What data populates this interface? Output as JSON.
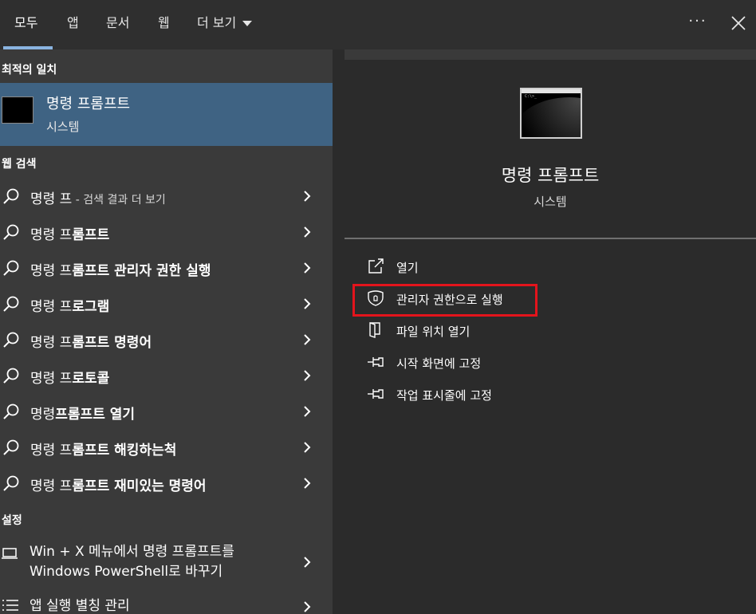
{
  "tabs": [
    {
      "label": "모두",
      "active": true
    },
    {
      "label": "앱"
    },
    {
      "label": "문서"
    },
    {
      "label": "웹"
    },
    {
      "label": "더 보기"
    }
  ],
  "sections": {
    "best_match": "최적의 일치",
    "web_search": "웹 검색",
    "settings": "설정"
  },
  "best_match": {
    "title": "명령 프롬프트",
    "subtitle": "시스템"
  },
  "web_results": [
    {
      "prefix": "명령 프",
      "bold": "",
      "hint": " - 검색 결과 더 보기"
    },
    {
      "prefix": "명령 프",
      "bold": "롬프트",
      "hint": ""
    },
    {
      "prefix": "명령 프",
      "bold": "롬프트 관리자 권한 실행",
      "hint": ""
    },
    {
      "prefix": "명령 프",
      "bold": "로그램",
      "hint": ""
    },
    {
      "prefix": "명령 프",
      "bold": "롬프트 명령어",
      "hint": ""
    },
    {
      "prefix": "명령 프",
      "bold": "로토콜",
      "hint": ""
    },
    {
      "prefix": "명령",
      "bold": "프롬프트 열기",
      "hint": ""
    },
    {
      "prefix": "명령 프",
      "bold": "롬프트 해킹하는척",
      "hint": ""
    },
    {
      "prefix": "명령 프",
      "bold": "롬프트 재미있는 명령어",
      "hint": ""
    }
  ],
  "settings_results": [
    {
      "line1": "Win + X 메뉴에서 명령 프롬프트를",
      "line2": "Windows PowerShell로 바꾸기"
    },
    {
      "line1": "앱 실행 별칭 관리",
      "line2": ""
    }
  ],
  "detail": {
    "title": "명령 프롬프트",
    "subtitle": "시스템",
    "icon_prompt": "C:\\>_",
    "actions": [
      {
        "label": "열기",
        "icon": "open-external-icon"
      },
      {
        "label": "관리자 권한으로 실행",
        "icon": "shield-icon"
      },
      {
        "label": "파일 위치 열기",
        "icon": "file-location-icon"
      },
      {
        "label": "시작 화면에 고정",
        "icon": "pin-icon"
      },
      {
        "label": "작업 표시줄에 고정",
        "icon": "pin-icon"
      }
    ]
  },
  "colors": {
    "highlight": "#e3141c",
    "selected_row": "#3f6383",
    "accent_underline": "#8ab4e0"
  }
}
